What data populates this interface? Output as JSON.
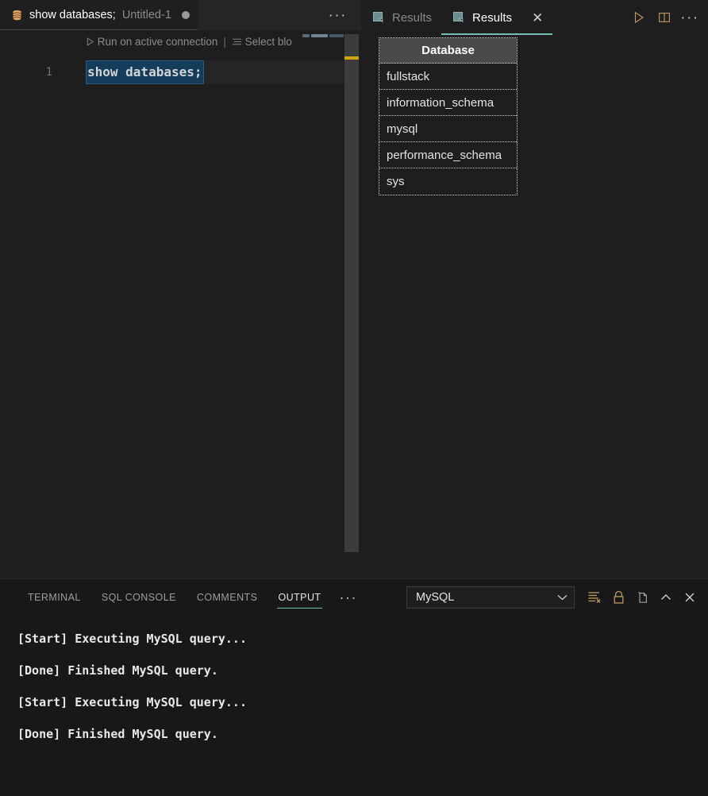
{
  "editor": {
    "tab": {
      "icon": "database-icon",
      "title": "show databases;",
      "subtitle": "Untitled-1",
      "dirty": true
    },
    "tabbar_more_label": "···",
    "codelens": {
      "run_label": "Run on active connection",
      "separator": "|",
      "select_label": "Select blo"
    },
    "lines": [
      {
        "number": "1",
        "text": "show databases;"
      }
    ],
    "scrollbar_marker_color": "#cfa700"
  },
  "results": {
    "tabs": [
      {
        "label": "Results",
        "active": false,
        "closable": false
      },
      {
        "label": "Results",
        "active": true,
        "closable": true
      }
    ],
    "close_glyph": "✕",
    "actions": [
      {
        "name": "run-query-button",
        "icon": "play-icon"
      },
      {
        "name": "split-editor-button",
        "icon": "split-editor-icon"
      },
      {
        "name": "results-more-button",
        "icon": "ellipsis-icon",
        "label": "···"
      }
    ],
    "table": {
      "columns": [
        "Database"
      ],
      "rows": [
        [
          "fullstack"
        ],
        [
          "information_schema"
        ],
        [
          "mysql"
        ],
        [
          "performance_schema"
        ],
        [
          "sys"
        ]
      ]
    }
  },
  "panel": {
    "tabs": [
      {
        "label": "TERMINAL",
        "active": false
      },
      {
        "label": "SQL CONSOLE",
        "active": false
      },
      {
        "label": "COMMENTS",
        "active": false
      },
      {
        "label": "OUTPUT",
        "active": true
      }
    ],
    "tabs_more_label": "···",
    "source_select": {
      "value": "MySQL",
      "options": [
        "MySQL"
      ]
    },
    "actions": [
      {
        "name": "clear-output-button",
        "icon": "clear-output-icon"
      },
      {
        "name": "lock-scroll-button",
        "icon": "lock-icon"
      },
      {
        "name": "open-in-editor-button",
        "icon": "open-in-editor-icon"
      },
      {
        "name": "collapse-panel-button",
        "icon": "chevron-up-icon"
      },
      {
        "name": "close-panel-button",
        "icon": "close-icon"
      }
    ],
    "output_lines": [
      "[Start] Executing MySQL query...",
      "[Done] Finished MySQL query.",
      "[Start] Executing MySQL query...",
      "[Done] Finished MySQL query."
    ]
  },
  "colors": {
    "accent_teal": "#75beb7",
    "db_icon_orange": "#e8a35c",
    "selection_blue": "#143c5b",
    "panel_bg": "#181818",
    "editor_bg": "#1e1e1e"
  }
}
